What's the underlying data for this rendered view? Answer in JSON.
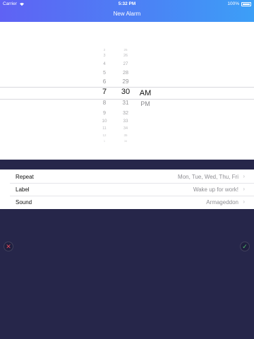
{
  "status": {
    "carrier": "Carrier",
    "time": "5:32 PM",
    "battery": "100%"
  },
  "header": {
    "title": "New Alarm"
  },
  "picker": {
    "hours": [
      "2",
      "3",
      "4",
      "5",
      "6",
      "7",
      "8",
      "9",
      "10",
      "11",
      "12",
      "1"
    ],
    "minutes": [
      "25",
      "26",
      "27",
      "28",
      "29",
      "30",
      "31",
      "32",
      "33",
      "34",
      "35",
      "36"
    ],
    "ampm": [
      "AM",
      "PM"
    ],
    "selected": {
      "hour": "7",
      "minute": "30",
      "ampm": "AM"
    }
  },
  "settings": [
    {
      "label": "Repeat",
      "value": "Mon, Tue, Wed, Thu, Fri"
    },
    {
      "label": "Label",
      "value": "Wake up for work!"
    },
    {
      "label": "Sound",
      "value": "Armageddon"
    }
  ],
  "actions": {
    "cancel_icon": "close-icon",
    "confirm_icon": "check-icon"
  }
}
